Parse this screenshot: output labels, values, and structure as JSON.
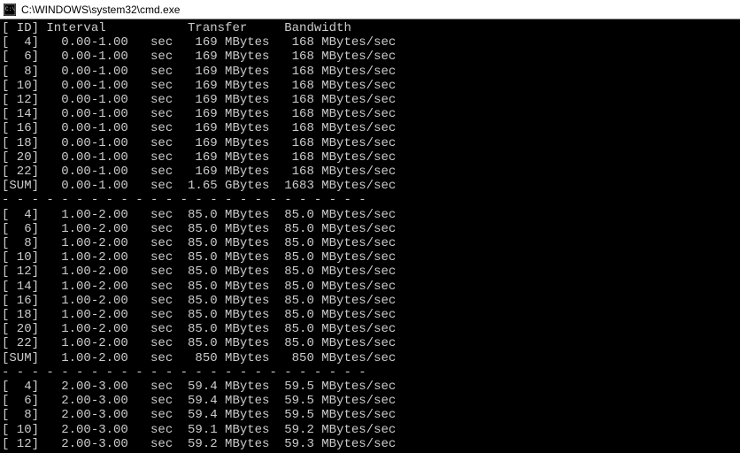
{
  "window": {
    "title": "C:\\WINDOWS\\system32\\cmd.exe"
  },
  "header": {
    "id": "ID",
    "interval": "Interval",
    "transfer": "Transfer",
    "bandwidth": "Bandwidth"
  },
  "separator": "- - - - - - - - - - - - - - - - - - - - - - - - -",
  "groups": [
    {
      "rows": [
        {
          "id": "  4",
          "interval": "0.00-1.00",
          "unit": "sec",
          "transfer": " 169 MBytes",
          "bandwidth": " 168 MBytes/sec"
        },
        {
          "id": "  6",
          "interval": "0.00-1.00",
          "unit": "sec",
          "transfer": " 169 MBytes",
          "bandwidth": " 168 MBytes/sec"
        },
        {
          "id": "  8",
          "interval": "0.00-1.00",
          "unit": "sec",
          "transfer": " 169 MBytes",
          "bandwidth": " 168 MBytes/sec"
        },
        {
          "id": " 10",
          "interval": "0.00-1.00",
          "unit": "sec",
          "transfer": " 169 MBytes",
          "bandwidth": " 168 MBytes/sec"
        },
        {
          "id": " 12",
          "interval": "0.00-1.00",
          "unit": "sec",
          "transfer": " 169 MBytes",
          "bandwidth": " 168 MBytes/sec"
        },
        {
          "id": " 14",
          "interval": "0.00-1.00",
          "unit": "sec",
          "transfer": " 169 MBytes",
          "bandwidth": " 168 MBytes/sec"
        },
        {
          "id": " 16",
          "interval": "0.00-1.00",
          "unit": "sec",
          "transfer": " 169 MBytes",
          "bandwidth": " 168 MBytes/sec"
        },
        {
          "id": " 18",
          "interval": "0.00-1.00",
          "unit": "sec",
          "transfer": " 169 MBytes",
          "bandwidth": " 168 MBytes/sec"
        },
        {
          "id": " 20",
          "interval": "0.00-1.00",
          "unit": "sec",
          "transfer": " 169 MBytes",
          "bandwidth": " 168 MBytes/sec"
        },
        {
          "id": " 22",
          "interval": "0.00-1.00",
          "unit": "sec",
          "transfer": " 169 MBytes",
          "bandwidth": " 168 MBytes/sec"
        },
        {
          "id": "SUM",
          "interval": "0.00-1.00",
          "unit": "sec",
          "transfer": "1.65 GBytes",
          "bandwidth": "1683 MBytes/sec"
        }
      ]
    },
    {
      "rows": [
        {
          "id": "  4",
          "interval": "1.00-2.00",
          "unit": "sec",
          "transfer": "85.0 MBytes",
          "bandwidth": "85.0 MBytes/sec"
        },
        {
          "id": "  6",
          "interval": "1.00-2.00",
          "unit": "sec",
          "transfer": "85.0 MBytes",
          "bandwidth": "85.0 MBytes/sec"
        },
        {
          "id": "  8",
          "interval": "1.00-2.00",
          "unit": "sec",
          "transfer": "85.0 MBytes",
          "bandwidth": "85.0 MBytes/sec"
        },
        {
          "id": " 10",
          "interval": "1.00-2.00",
          "unit": "sec",
          "transfer": "85.0 MBytes",
          "bandwidth": "85.0 MBytes/sec"
        },
        {
          "id": " 12",
          "interval": "1.00-2.00",
          "unit": "sec",
          "transfer": "85.0 MBytes",
          "bandwidth": "85.0 MBytes/sec"
        },
        {
          "id": " 14",
          "interval": "1.00-2.00",
          "unit": "sec",
          "transfer": "85.0 MBytes",
          "bandwidth": "85.0 MBytes/sec"
        },
        {
          "id": " 16",
          "interval": "1.00-2.00",
          "unit": "sec",
          "transfer": "85.0 MBytes",
          "bandwidth": "85.0 MBytes/sec"
        },
        {
          "id": " 18",
          "interval": "1.00-2.00",
          "unit": "sec",
          "transfer": "85.0 MBytes",
          "bandwidth": "85.0 MBytes/sec"
        },
        {
          "id": " 20",
          "interval": "1.00-2.00",
          "unit": "sec",
          "transfer": "85.0 MBytes",
          "bandwidth": "85.0 MBytes/sec"
        },
        {
          "id": " 22",
          "interval": "1.00-2.00",
          "unit": "sec",
          "transfer": "85.0 MBytes",
          "bandwidth": "85.0 MBytes/sec"
        },
        {
          "id": "SUM",
          "interval": "1.00-2.00",
          "unit": "sec",
          "transfer": " 850 MBytes",
          "bandwidth": " 850 MBytes/sec"
        }
      ]
    },
    {
      "rows": [
        {
          "id": "  4",
          "interval": "2.00-3.00",
          "unit": "sec",
          "transfer": "59.4 MBytes",
          "bandwidth": "59.5 MBytes/sec"
        },
        {
          "id": "  6",
          "interval": "2.00-3.00",
          "unit": "sec",
          "transfer": "59.4 MBytes",
          "bandwidth": "59.5 MBytes/sec"
        },
        {
          "id": "  8",
          "interval": "2.00-3.00",
          "unit": "sec",
          "transfer": "59.4 MBytes",
          "bandwidth": "59.5 MBytes/sec"
        },
        {
          "id": " 10",
          "interval": "2.00-3.00",
          "unit": "sec",
          "transfer": "59.1 MBytes",
          "bandwidth": "59.2 MBytes/sec"
        },
        {
          "id": " 12",
          "interval": "2.00-3.00",
          "unit": "sec",
          "transfer": "59.2 MBytes",
          "bandwidth": "59.3 MBytes/sec"
        }
      ]
    }
  ]
}
